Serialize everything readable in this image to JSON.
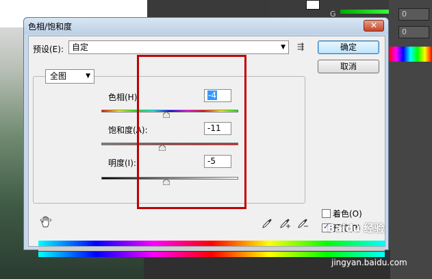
{
  "background_app": {
    "channel_g_label": "G",
    "field_values": [
      "0",
      "0"
    ]
  },
  "dialog": {
    "title": "色相/饱和度",
    "close_glyph": "✕",
    "preset_label": "预设(E):",
    "preset_value": "自定",
    "ok_button": "确定",
    "cancel_button": "取消",
    "channel_value": "全图",
    "hue": {
      "label": "色相(H):",
      "value": "-4"
    },
    "saturation": {
      "label": "饱和度(A):",
      "value": "-11"
    },
    "lightness": {
      "label": "明度(I):",
      "value": "-5"
    },
    "colorize": {
      "label": "着色(O)",
      "checked": false
    },
    "preview": {
      "label": "预览(P)",
      "checked": true
    }
  },
  "watermark": {
    "brand": "Baidu 经验",
    "url": "jingyan.baidu.com"
  }
}
